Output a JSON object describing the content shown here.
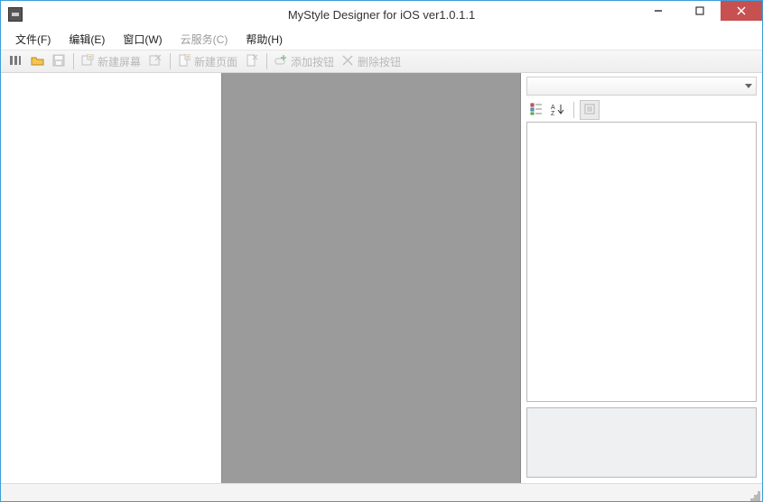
{
  "window": {
    "title": "MyStyle Designer for iOS ver1.0.1.1"
  },
  "menu": {
    "file": "文件(F)",
    "edit": "编辑(E)",
    "window": "窗口(W)",
    "cloud": "云服务(C)",
    "help": "帮助(H)"
  },
  "toolbar": {
    "new_screen": "新建屏幕",
    "new_page": "新建页面",
    "add_button": "添加按钮",
    "del_button": "删除按钮"
  },
  "right_panel": {
    "combo_selected": ""
  },
  "colors": {
    "window_border": "#3c9ed8",
    "canvas_bg": "#9b9b9b",
    "close_btn": "#c75050"
  }
}
